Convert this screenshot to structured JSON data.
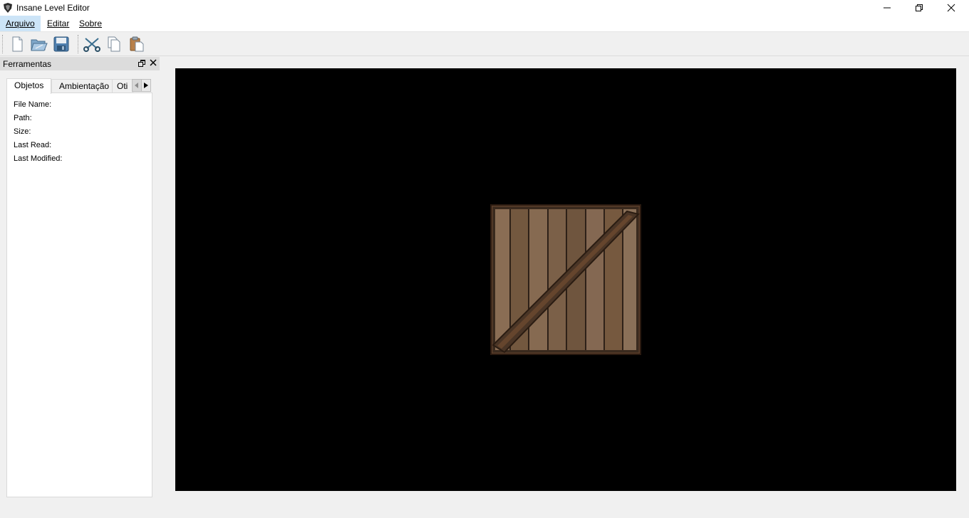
{
  "window": {
    "title": "Insane Level Editor",
    "controls": {
      "minimize": "—",
      "maximize": "❐",
      "close": "✕"
    }
  },
  "menu": {
    "items": [
      "Arquivo",
      "Editar",
      "Sobre"
    ]
  },
  "toolbar": {
    "buttons": [
      "new-file-icon",
      "open-folder-icon",
      "save-icon",
      "cut-icon",
      "copy-icon",
      "paste-icon"
    ]
  },
  "dock": {
    "title": "Ferramentas",
    "tabs": [
      "Objetos",
      "Ambientação",
      "Oti"
    ],
    "active_tab": "Objetos",
    "fields": [
      "File Name:",
      "Path:",
      "Size:",
      "Last Read:",
      "Last Modified:"
    ]
  },
  "viewport": {
    "background": "#000000",
    "object": "wooden-crate"
  },
  "colors": {
    "titlebar": "#ffffff",
    "menu_highlight": "#cce4f7",
    "panel_header": "#dcdcdc",
    "window_bg": "#f0f0f0"
  }
}
